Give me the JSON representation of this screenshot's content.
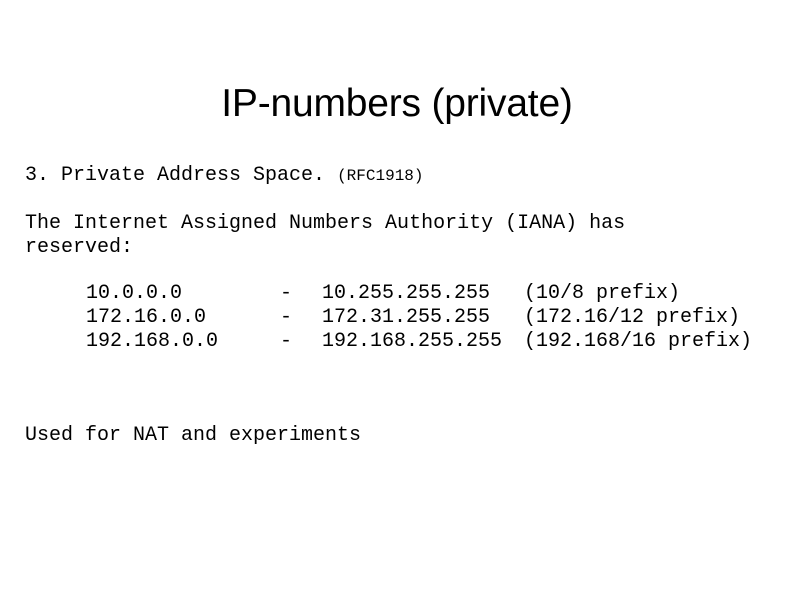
{
  "slide": {
    "title": "IP-numbers (private)",
    "section_number_and_name": "3. Private Address Space.",
    "rfc_reference": "(RFC1918)",
    "paragraph_lines": [
      "The Internet Assigned Numbers Authority (IANA) has",
      "reserved:"
    ],
    "address_table": {
      "rows": [
        {
          "start": "10.0.0.0",
          "separator": "-",
          "end": "10.255.255.255",
          "prefix": "(10/8 prefix)"
        },
        {
          "start": "172.16.0.0",
          "separator": "-",
          "end": "172.31.255.255",
          "prefix": "(172.16/12 prefix)"
        },
        {
          "start": "192.168.0.0",
          "separator": "-",
          "end": "192.168.255.255",
          "prefix": "(192.168/16 prefix)"
        }
      ]
    },
    "footer_note": "Used for NAT and experiments",
    "colors": {
      "background": "#ffffff",
      "text": "#000000"
    }
  }
}
